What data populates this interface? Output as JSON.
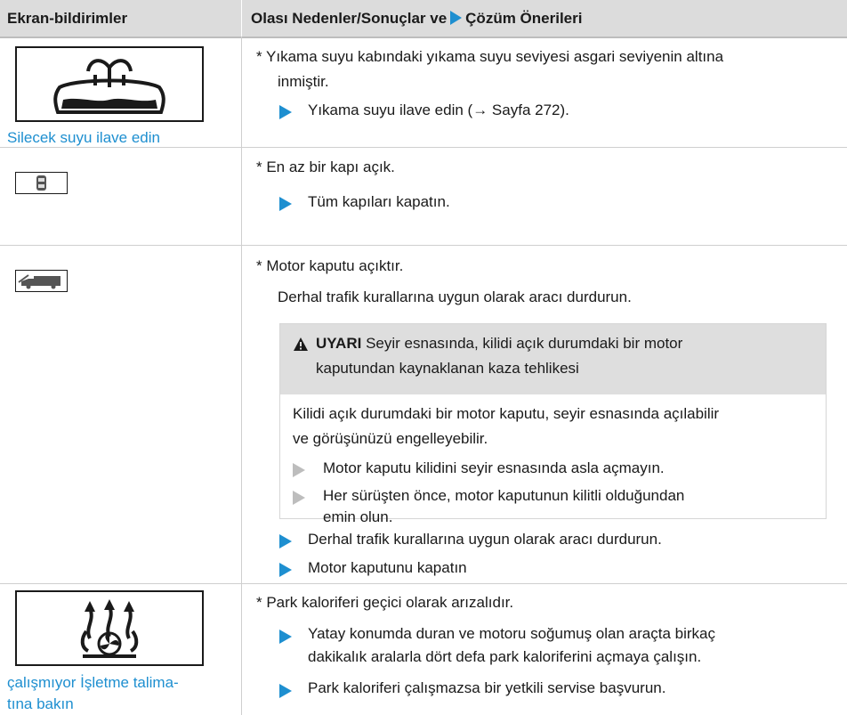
{
  "header": {
    "col1": "Ekran-bildirimler",
    "col2_pre": "Olası Nedenler/Sonuçlar ve",
    "col2_post": "Çözüm Önerileri"
  },
  "rows": [
    {
      "icon": "washer-fluid-icon",
      "label": "Silecek suyu ilave edin",
      "cause": "* Yıkama suyu kabındaki yıkama suyu seviyesi asgari seviyenin altına",
      "cause2": "inmiştir.",
      "actions": [
        "Yıkama suyu ilave edin (→ Sayfa 272)."
      ]
    },
    {
      "icon": "door-open-icon",
      "cause": "* En az bir kapı açık.",
      "actions": [
        "Tüm kapıları kapatın."
      ]
    },
    {
      "icon": "hood-open-icon",
      "cause": "* Motor kaputu açıktır.",
      "note": "Derhal trafik kurallarına uygun olarak aracı durdurun.",
      "warning": {
        "title": "UYARI",
        "title_rest": "Seyir esnasında, kilidi açık durumdaki bir motor",
        "title_line2": "kaputundan kaynaklanan kaza tehlikesi",
        "body1": "Kilidi açık durumdaki bir motor kaputu, seyir esnasında açılabilir",
        "body2": "ve görüşünüzü engelleyebilir.",
        "items": [
          "Motor kaputu kilidini seyir esnasında asla açmayın.",
          "Her sürüşten önce, motor kaputunun kilitli olduğundan",
          "emin olun."
        ]
      },
      "actions": [
        "Derhal trafik kurallarına uygun olarak aracı durdurun.",
        "Motor kaputunu kapatın"
      ]
    },
    {
      "icon": "parking-heater-icon",
      "label1": "çalışmıyor İşletme talima-",
      "label2": "tına bakın",
      "cause": "* Park kaloriferi geçici olarak arızalıdır.",
      "actions": [
        "Yatay konumda duran ve motoru soğumuş olan araçta birkaç",
        "dakikalık aralarla dört defa park kaloriferini açmaya çalışın.",
        "Park kaloriferi çalışmazsa bir yetkili servise başvurun."
      ]
    }
  ],
  "colors": {
    "accent": "#1e8fd0",
    "header_bg": "#dcdcdc",
    "warn_bg": "#dedede"
  }
}
